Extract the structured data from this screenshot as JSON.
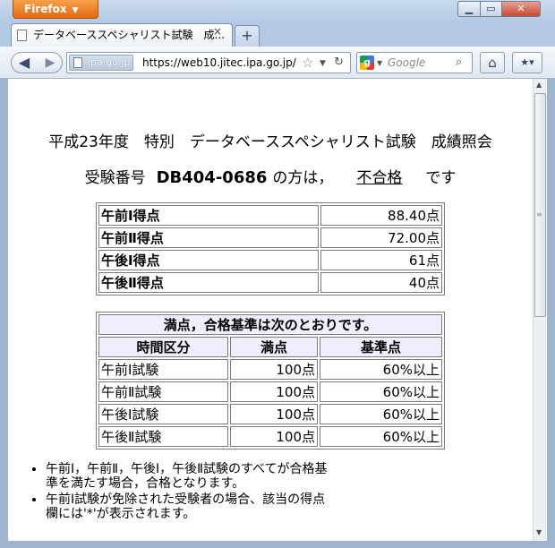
{
  "browser": {
    "app_button": "Firefox",
    "tab_title": "データベーススペシャリスト試験　成...",
    "site_identity": "ipa.go.jp",
    "url": "https://web10.jitec.ipa.go.jp/",
    "search_placeholder": "Google",
    "new_tab_label": "+",
    "close_tab_label": "×"
  },
  "page": {
    "heading": "平成23年度　特別　データベーススペシャリスト試験　成績照会",
    "result_prefix": "受験番号",
    "exam_number": "DB404-0686",
    "result_middle": "の方は，",
    "result_status": "不合格",
    "result_suffix": "です"
  },
  "scores": [
    {
      "label": "午前Ⅰ得点",
      "value": "88.40点"
    },
    {
      "label": "午前Ⅱ得点",
      "value": "72.00点"
    },
    {
      "label": "午後Ⅰ得点",
      "value": "61点"
    },
    {
      "label": "午後Ⅱ得点",
      "value": "40点"
    }
  ],
  "criteria": {
    "caption": "満点，合格基準は次のとおりです。",
    "headers": [
      "時間区分",
      "満点",
      "基準点"
    ],
    "rows": [
      [
        "午前Ⅰ試験",
        "100点",
        "60%以上"
      ],
      [
        "午前Ⅱ試験",
        "100点",
        "60%以上"
      ],
      [
        "午後Ⅰ試験",
        "100点",
        "60%以上"
      ],
      [
        "午後Ⅱ試験",
        "100点",
        "60%以上"
      ]
    ]
  },
  "notes": [
    "午前Ⅰ，午前Ⅱ，午後Ⅰ，午後Ⅱ試験のすべてが合格基準を満たす場合，合格となります。",
    "午前Ⅰ試験が免除された受験者の場合、該当の得点欄には'*'が表示されます。"
  ]
}
